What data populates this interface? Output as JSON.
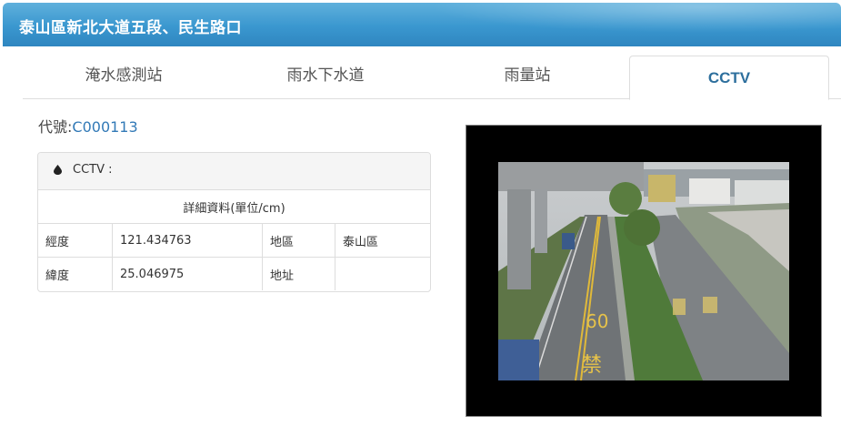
{
  "window": {
    "title": "泰山區新北大道五段、民生路口"
  },
  "tabs": [
    {
      "label": "淹水感測站",
      "active": false
    },
    {
      "label": "雨水下水道",
      "active": false
    },
    {
      "label": "雨量站",
      "active": false
    },
    {
      "label": "CCTV",
      "active": true
    }
  ],
  "info": {
    "code_label": "代號:",
    "code_value": "C000113"
  },
  "panel": {
    "header": "CCTV :",
    "subtitle": "詳細資料(單位/cm)",
    "rows": [
      {
        "k1": "經度",
        "v1": "121.434763",
        "k2": "地區",
        "v2": "泰山區"
      },
      {
        "k1": "緯度",
        "v1": "25.046975",
        "k2": "地址",
        "v2": ""
      }
    ]
  },
  "cctv": {
    "road_marking_speed": "60",
    "road_marking_text": "禁"
  },
  "colors": {
    "title_bar": "#3a97cf",
    "active_tab_text": "#2d6f9d",
    "code_value": "#337ab7"
  },
  "icons": {
    "panel_header": "water-drop-icon"
  }
}
